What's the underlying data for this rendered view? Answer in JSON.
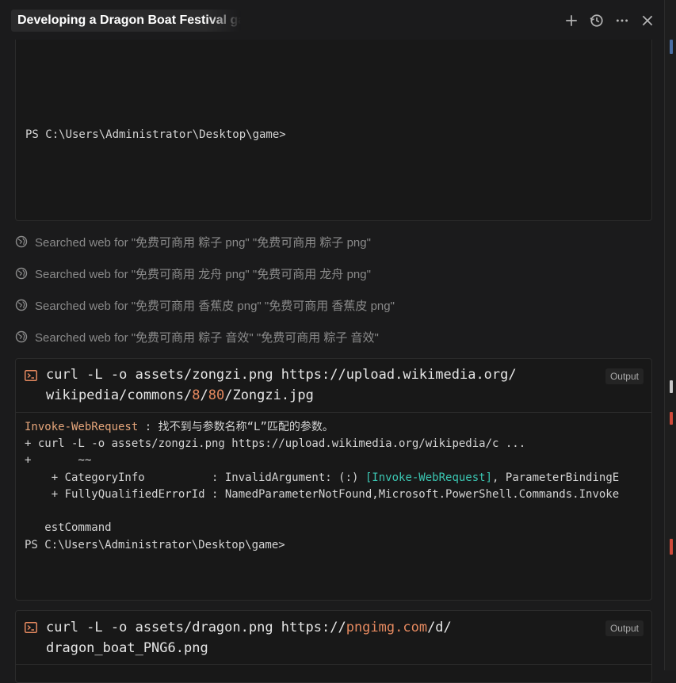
{
  "header": {
    "title": "Developing a Dragon Boat Festival game",
    "icons": [
      "plus-icon",
      "history-icon",
      "more-icon",
      "close-icon"
    ]
  },
  "terminal_top": {
    "prompt": "PS C:\\Users\\Administrator\\Desktop\\game>"
  },
  "searches": [
    {
      "label": "Searched web for \"免费可商用 粽子 png\" \"免费可商用 粽子 png\""
    },
    {
      "label": "Searched web for \"免费可商用 龙舟 png\" \"免费可商用 龙舟 png\""
    },
    {
      "label": "Searched web for \"免费可商用 香蕉皮 png\" \"免费可商用 香蕉皮 png\""
    },
    {
      "label": "Searched web for \"免费可商用 粽子 音效\" \"免费可商用 粽子 音效\""
    }
  ],
  "commands": [
    {
      "line1_prefix": "curl -L -o assets/zongzi.png https://upload.wikimedia.org/",
      "line2_a": "wikipedia/commons/",
      "line2_num1": "8",
      "line2_b": "/",
      "line2_num2": "80",
      "line2_c": "/Zongzi.jpg",
      "output_label": "Output",
      "output": {
        "err_name": "Invoke-WebRequest",
        "err_msg": " : 找不到与参数名称“L”匹配的参数。",
        "line2": "+ curl -L -o assets/zongzi.png https://upload.wikimedia.org/wikipedia/c ...",
        "line3": "+       ~~",
        "line4_a": "    + CategoryInfo          : InvalidArgument: (:) ",
        "line4_b": "[Invoke-WebRequest]",
        "line4_c": ", ParameterBindingE",
        "line5": "    + FullyQualifiedErrorId : NamedParameterNotFound,Microsoft.PowerShell.Commands.Invoke",
        "line6": "   estCommand",
        "prompt": "PS C:\\Users\\Administrator\\Desktop\\game>"
      }
    },
    {
      "line1_prefix": "curl -L -o assets/dragon.png https://",
      "line1_url": "pngimg.com",
      "line1_suffix": "/d/",
      "line2": "dragon_boat_PNG6.png",
      "output_label": "Output"
    }
  ],
  "colors": {
    "background": "#1b1b1c",
    "panel": "#181818",
    "accent_orange": "#e5895f",
    "teal": "#3bc7b3"
  }
}
